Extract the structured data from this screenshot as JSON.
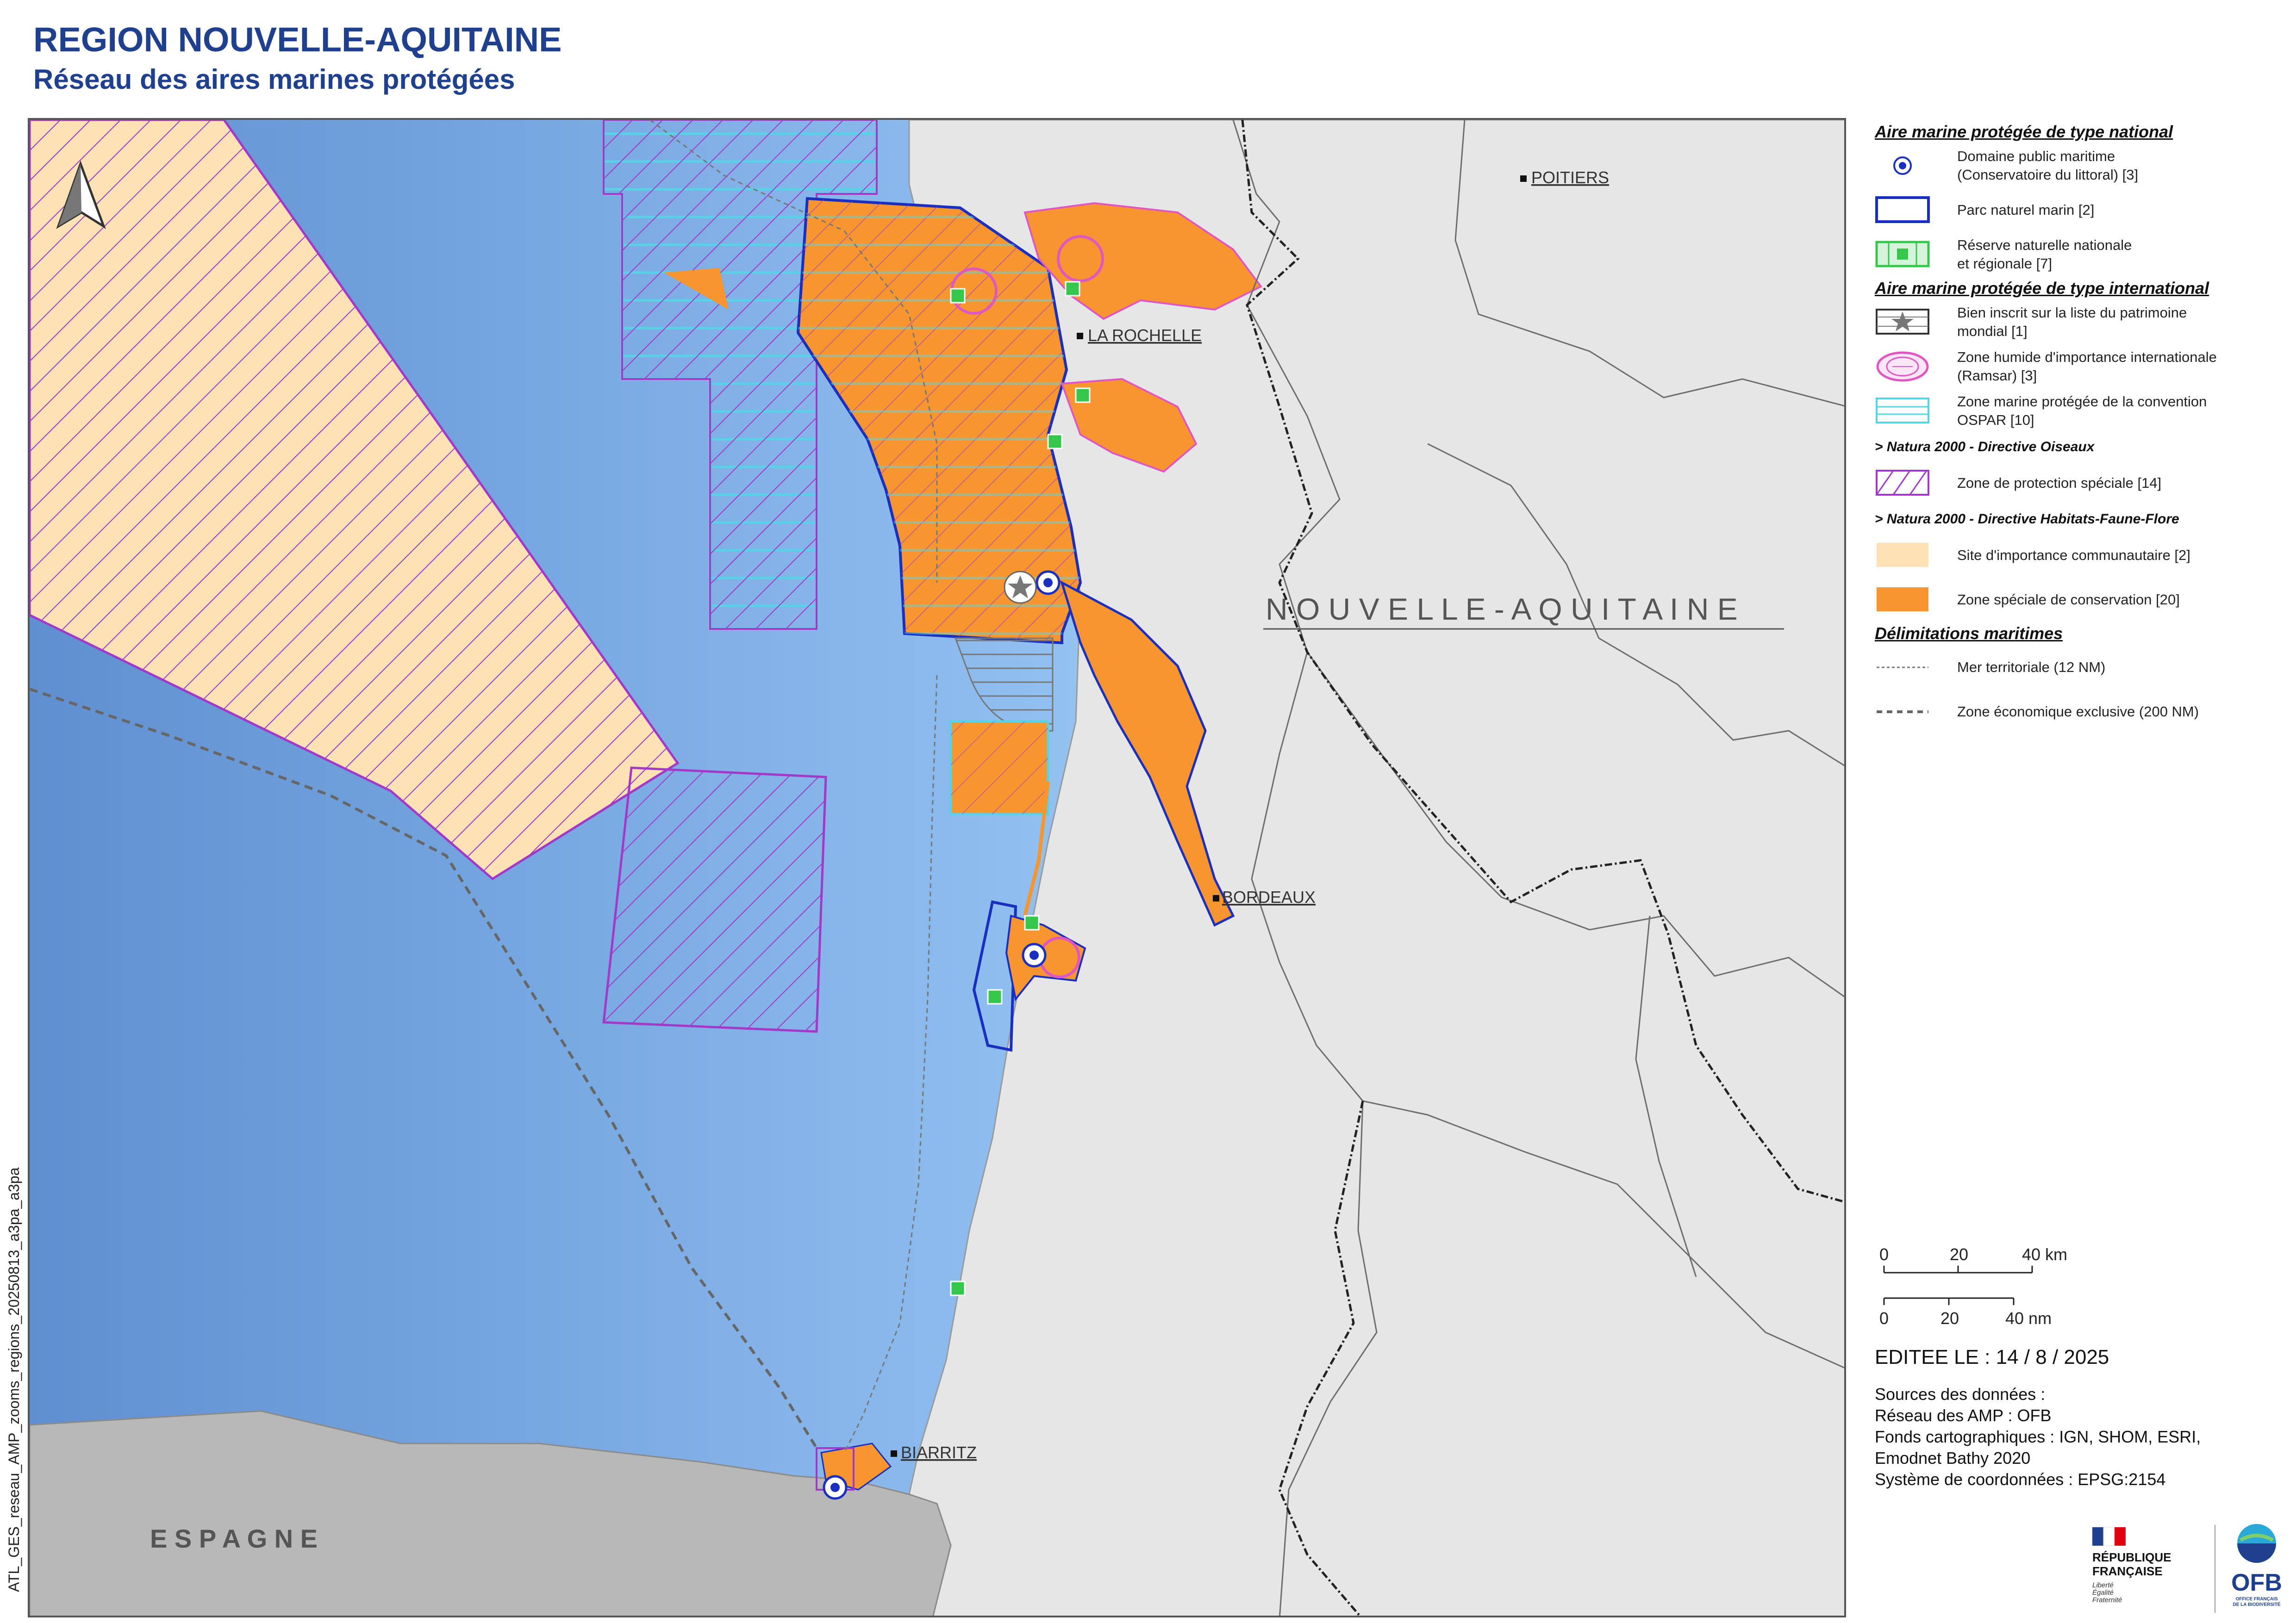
{
  "title": {
    "main": "REGION NOUVELLE-AQUITAINE",
    "sub": "Réseau des aires marines protégées"
  },
  "map": {
    "places": {
      "poitiers": "POITIERS",
      "la_rochelle": "LA ROCHELLE",
      "bordeaux": "BORDEAUX",
      "biarritz": "BIARRITZ",
      "region": "N O U V E L L E - A Q U I T A I N E",
      "espagne": "E S P A G N E"
    },
    "colors": {
      "sea_deep": "#6f9fd8",
      "sea_shallow": "#cfe6fb",
      "land": "#e6e6e6",
      "spain": "#b8b8b8",
      "zsc": "#f7962e",
      "sic": "#fde2b6",
      "zps": "#a339c9",
      "ospar": "#56d3e6",
      "pnm": "#1a2fbf",
      "ramsar": "#e056c2",
      "reserve": "#35c74b"
    }
  },
  "side_label": "ATL_GES_reseau_AMP_zooms_regions_20250813_a3pa_a3pa",
  "legend": {
    "national_heading": "Aire marine protégée de type national",
    "national": [
      {
        "icon": "dpm-dot-icon",
        "text": [
          "Domaine public maritime",
          "(Conservatoire du littoral) [3]"
        ]
      },
      {
        "icon": "parc-marin-icon",
        "text": [
          "Parc naturel marin [2]"
        ]
      },
      {
        "icon": "reserve-icon",
        "text": [
          "Réserve naturelle nationale",
          "et régionale [7]"
        ]
      }
    ],
    "international_heading": "Aire marine protégée de type international",
    "international": [
      {
        "icon": "star-icon",
        "text": [
          "Bien inscrit sur la liste du patrimoine",
          "mondial [1]"
        ]
      },
      {
        "icon": "ramsar-icon",
        "text": [
          "Zone humide d'importance internationale",
          "(Ramsar) [3]"
        ]
      },
      {
        "icon": "ospar-icon",
        "text": [
          "Zone marine protégée de la convention",
          "OSPAR [10]"
        ]
      }
    ],
    "oiseaux_heading": "> Natura 2000 - Directive Oiseaux",
    "oiseaux": [
      {
        "icon": "zps-icon",
        "text": [
          "Zone de protection spéciale [14]"
        ]
      }
    ],
    "habitats_heading": "> Natura 2000 - Directive Habitats-Faune-Flore",
    "habitats": [
      {
        "icon": "sic-icon",
        "text": [
          "Site d'importance communautaire [2]"
        ]
      },
      {
        "icon": "zsc-icon",
        "text": [
          "Zone spéciale de conservation [20]"
        ]
      }
    ],
    "delim_heading": "Délimitations maritimes",
    "delim": [
      {
        "icon": "territorial-line-icon",
        "text": [
          "Mer territoriale (12 NM)"
        ]
      },
      {
        "icon": "zee-line-icon",
        "text": [
          "Zone économique exclusive (200 NM)"
        ]
      }
    ]
  },
  "scale": {
    "km": [
      "0",
      "20",
      "40 km"
    ],
    "nm": [
      "0",
      "20",
      "40 nm"
    ]
  },
  "edition": "EDITEE LE : 14 / 8 / 2025",
  "sources": [
    "Sources des données :",
    "Réseau des AMP : OFB",
    "Fonds cartographiques : IGN, SHOM, ESRI,",
    "Emodnet Bathy 2020",
    "Système de coordonnées : EPSG:2154"
  ],
  "logos": {
    "rf": [
      "RÉPUBLIQUE",
      "FRANÇAISE"
    ],
    "rf_motto": [
      "Liberté",
      "Égalité",
      "Fraternité"
    ],
    "ofb": "OFB",
    "ofb_sub": [
      "OFFICE FRANÇAIS",
      "DE LA BIODIVERSITÉ"
    ]
  }
}
